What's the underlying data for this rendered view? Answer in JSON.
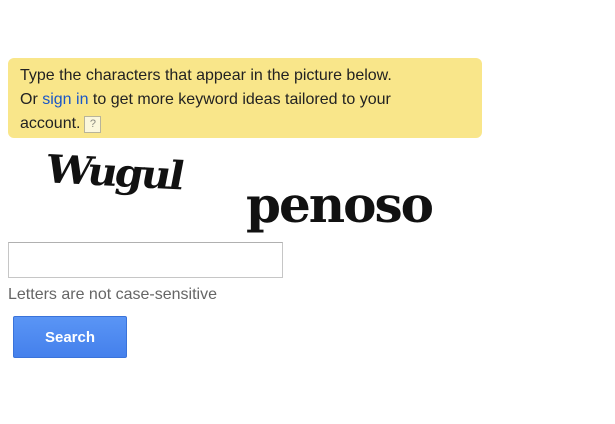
{
  "notice": {
    "line1": "Type the characters that appear in the picture below.",
    "line2_prefix": "Or ",
    "sign_in_link": "sign in",
    "line2_suffix": " to get more keyword ideas tailored to your",
    "line3": "account.",
    "help_icon_glyph": "?",
    "background_color": "#f9e68a",
    "link_color": "#1a57c7"
  },
  "captcha": {
    "word1": "Wugul",
    "word2": "penoso"
  },
  "answer": {
    "value": "",
    "placeholder": ""
  },
  "hint": "Letters are not case-sensitive",
  "search_button": {
    "label": "Search",
    "color": "#4d88f0"
  }
}
